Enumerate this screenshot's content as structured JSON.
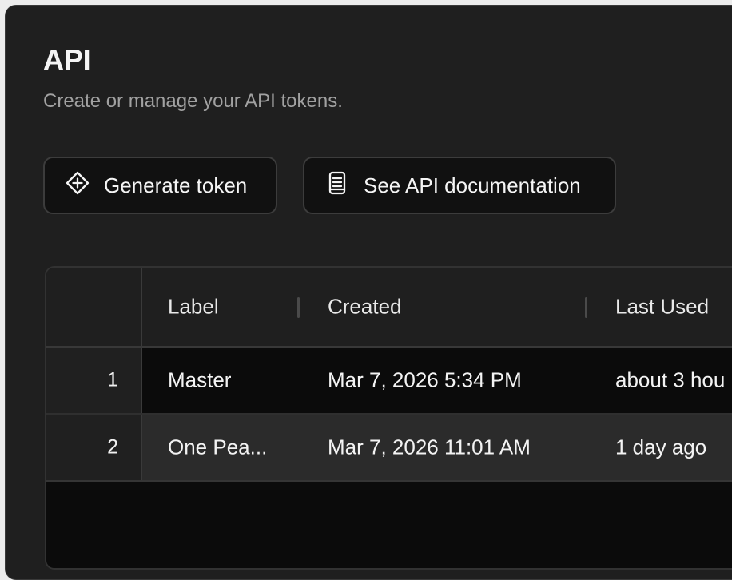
{
  "page": {
    "title": "API",
    "subtitle": "Create or manage your API tokens."
  },
  "actions": {
    "generate_label": "Generate token",
    "docs_label": "See API documentation"
  },
  "table": {
    "columns": [
      "Label",
      "Created",
      "Last Used"
    ],
    "rows": [
      {
        "index": "1",
        "label": "Master",
        "created": "Mar 7, 2026 5:34 PM",
        "last_used": "about 3 hou"
      },
      {
        "index": "2",
        "label": "One Pea...",
        "created": "Mar 7, 2026 11:01 AM",
        "last_used": "1 day ago"
      }
    ]
  },
  "icons": {
    "generate": "diamond-plus-icon",
    "docs": "document-icon"
  }
}
